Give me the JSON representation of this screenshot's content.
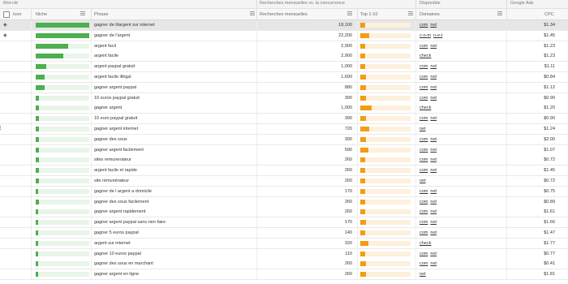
{
  "group_headers": {
    "keyword": "Mot-clé",
    "competition": "Recherches mensuelles vs. la concurrence",
    "available": "Disponible",
    "google_ads": "Google Ads"
  },
  "columns": {
    "icon": "Icon",
    "niche": "Niche",
    "phrase": "Phrase",
    "monthly": "Recherches mensuelles",
    "top": "Top 1-10",
    "domains": "Domaines",
    "cpc": "CPC"
  },
  "rows": [
    {
      "icon": "diamond-icon",
      "niche": 1.0,
      "phrase": "gagner de lilargent sur internet",
      "volume": "18,100",
      "top": 0.1,
      "domains": [
        "com",
        "net"
      ],
      "cpc": "$1.34",
      "selected": true
    },
    {
      "icon": "diamond-icon",
      "niche": 1.0,
      "phrase": "gagner de l'argent",
      "volume": "22,200",
      "top": 0.18,
      "domains": [
        "c-o-m",
        "n-e-t"
      ],
      "cpc": "$1.45"
    },
    {
      "icon": "",
      "niche": 0.6,
      "phrase": "argent facil",
      "volume": "2,900",
      "top": 0.09,
      "domains": [
        "com",
        "net"
      ],
      "cpc": "$1.23"
    },
    {
      "icon": "",
      "niche": 0.52,
      "phrase": "argent facile",
      "volume": "2,900",
      "top": 0.09,
      "domains": [
        "check"
      ],
      "cpc": "$1.23"
    },
    {
      "icon": "",
      "niche": 0.2,
      "phrase": "argent paypal gratuit",
      "volume": "1,000",
      "top": 0.09,
      "domains": [
        "com",
        "net"
      ],
      "cpc": "$1.11"
    },
    {
      "icon": "",
      "niche": 0.16,
      "phrase": "argent facile illégal",
      "volume": "1,600",
      "top": 0.12,
      "domains": [
        "com",
        "net"
      ],
      "cpc": "$0.84"
    },
    {
      "icon": "",
      "niche": 0.16,
      "phrase": "gagner argent paypal",
      "volume": "880",
      "top": 0.12,
      "domains": [
        "com",
        "net"
      ],
      "cpc": "$1.12"
    },
    {
      "icon": "",
      "niche": 0.06,
      "phrase": "10 euros paypal gratuit",
      "volume": "390",
      "top": 0.12,
      "domains": [
        "com",
        "net"
      ],
      "cpc": "$0.90"
    },
    {
      "icon": "",
      "niche": 0.06,
      "phrase": "gagner argent",
      "volume": "1,000",
      "top": 0.22,
      "domains": [
        "check"
      ],
      "cpc": "$1.20"
    },
    {
      "icon": "",
      "niche": 0.06,
      "phrase": "10 euro paypal gratuit",
      "volume": "390",
      "top": 0.12,
      "domains": [
        "com",
        "net"
      ],
      "cpc": "$0.90"
    },
    {
      "icon": "",
      "niche": 0.06,
      "phrase": "gagner argent internet",
      "volume": "720",
      "top": 0.18,
      "domains": [
        "net"
      ],
      "cpc": "$1.24"
    },
    {
      "icon": "",
      "niche": 0.06,
      "phrase": "gagner des sous",
      "volume": "390",
      "top": 0.12,
      "domains": [
        "com",
        "net"
      ],
      "cpc": "$2.00"
    },
    {
      "icon": "",
      "niche": 0.06,
      "phrase": "gagner argent facilement",
      "volume": "590",
      "top": 0.16,
      "domains": [
        "com",
        "net"
      ],
      "cpc": "$1.07"
    },
    {
      "icon": "",
      "niche": 0.06,
      "phrase": "sites remunerateur",
      "volume": "260",
      "top": 0.09,
      "domains": [
        "com",
        "net"
      ],
      "cpc": "$0.72"
    },
    {
      "icon": "",
      "niche": 0.06,
      "phrase": "argent facile et rapide",
      "volume": "260",
      "top": 0.09,
      "domains": [
        "com",
        "net"
      ],
      "cpc": "$1.45"
    },
    {
      "icon": "",
      "niche": 0.06,
      "phrase": "site rémunérateur",
      "volume": "260",
      "top": 0.09,
      "domains": [
        "net"
      ],
      "cpc": "$0.72"
    },
    {
      "icon": "",
      "niche": 0.04,
      "phrase": "gagner de l argent a domicile",
      "volume": "170",
      "top": 0.1,
      "domains": [
        "com",
        "net"
      ],
      "cpc": "$0.75"
    },
    {
      "icon": "",
      "niche": 0.06,
      "phrase": "gagner des sous facilement",
      "volume": "260",
      "top": 0.1,
      "domains": [
        "com",
        "net"
      ],
      "cpc": "$0.89"
    },
    {
      "icon": "",
      "niche": 0.04,
      "phrase": "gagner argent rapidement",
      "volume": "260",
      "top": 0.09,
      "domains": [
        "com",
        "net"
      ],
      "cpc": "$1.61"
    },
    {
      "icon": "",
      "niche": 0.04,
      "phrase": "gagner argent paypal sans rien faire",
      "volume": "170",
      "top": 0.12,
      "domains": [
        "com",
        "net"
      ],
      "cpc": "$1.66"
    },
    {
      "icon": "",
      "niche": 0.04,
      "phrase": "gagner 5 euros paypal",
      "volume": "140",
      "top": 0.1,
      "domains": [
        "com",
        "net"
      ],
      "cpc": "$1.47"
    },
    {
      "icon": "",
      "niche": 0.04,
      "phrase": "argent sur internet",
      "volume": "320",
      "top": 0.16,
      "domains": [
        "check"
      ],
      "cpc": "$1.77"
    },
    {
      "icon": "",
      "niche": 0.04,
      "phrase": "gagner 10 euros paypal",
      "volume": "110",
      "top": 0.09,
      "domains": [
        "com",
        "net"
      ],
      "cpc": "$0.77"
    },
    {
      "icon": "",
      "niche": 0.04,
      "phrase": "gagner des sous en marchant",
      "volume": "260",
      "top": 0.12,
      "domains": [
        "com",
        "net"
      ],
      "cpc": "$0.41"
    },
    {
      "icon": "",
      "niche": 0.04,
      "phrase": "gagner argent en ligne",
      "volume": "260",
      "top": 0.12,
      "domains": [
        "net"
      ],
      "cpc": "$1.81"
    }
  ],
  "colors": {
    "niche_fill": "#4caf50",
    "niche_track": "#e8f5e8",
    "top_fill": "#f39c12",
    "top_track": "#fdf0dc",
    "selected_row": "#e6e6e6"
  }
}
